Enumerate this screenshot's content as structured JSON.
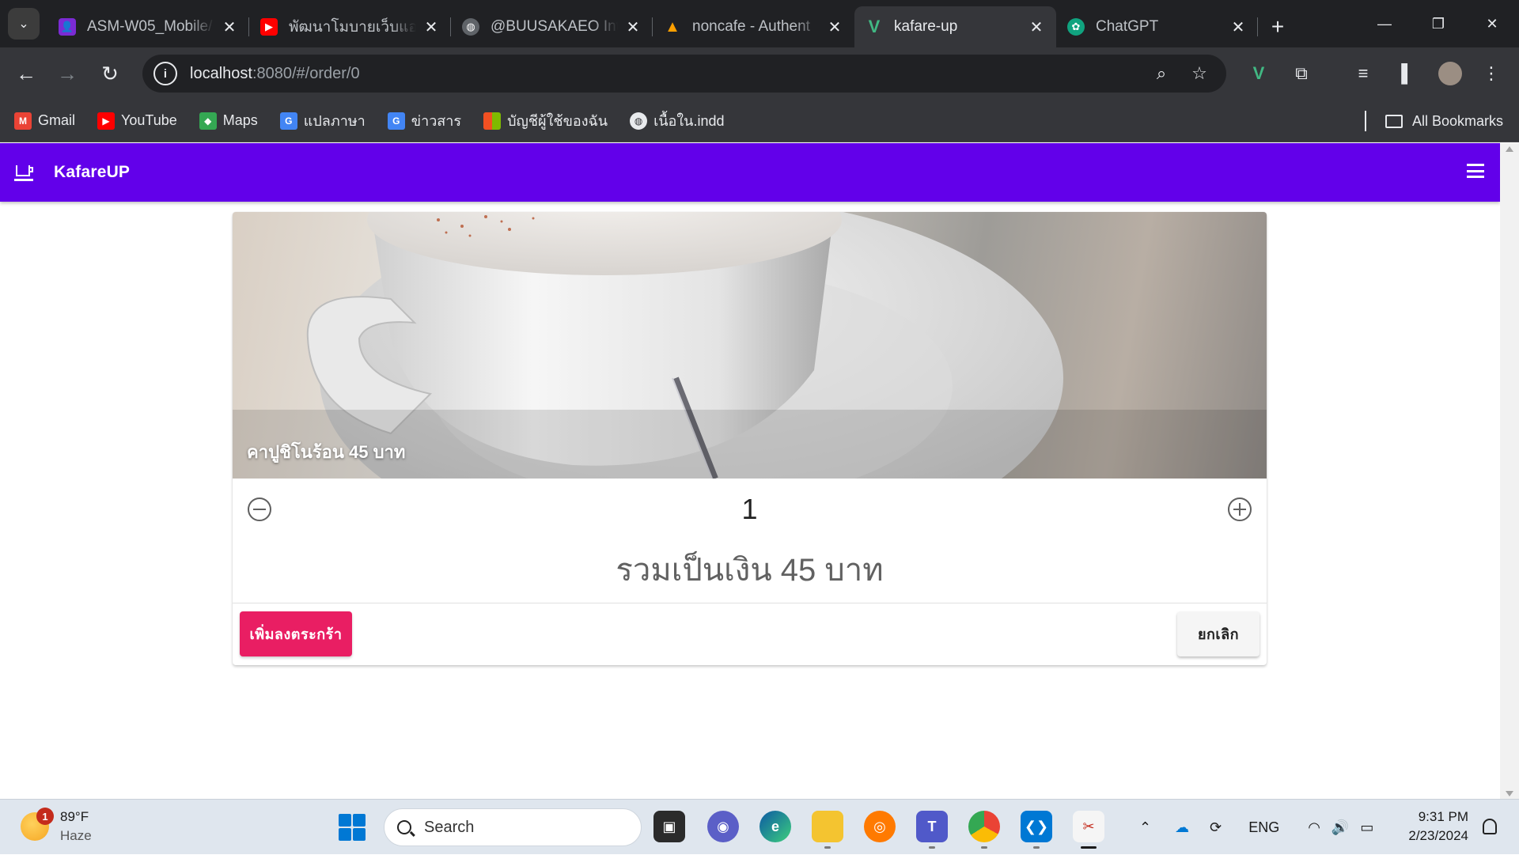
{
  "browser": {
    "tabs": [
      {
        "title": "ASM-W05_Mobile/",
        "icon": "person-icon",
        "color": "#7b2bd4",
        "active": false
      },
      {
        "title": "พัฒนาโมบายเว็บแอปแ",
        "icon": "youtube-icon",
        "color": "#ff0000",
        "active": false
      },
      {
        "title": "@BUUSAKAEO Inte",
        "icon": "globe-icon",
        "color": "#5f6368",
        "active": false
      },
      {
        "title": "noncafe - Authent",
        "icon": "firebase-icon",
        "color": "#ffa000",
        "active": false
      },
      {
        "title": "kafare-up",
        "icon": "vue-icon",
        "color": "#41b883",
        "active": true
      },
      {
        "title": "ChatGPT",
        "icon": "chatgpt-icon",
        "color": "#10a37f",
        "active": false
      }
    ],
    "url_host": "localhost",
    "url_rest": ":8080/#/order/0",
    "bookmarks": [
      {
        "label": "Gmail",
        "icon": "gmail-icon",
        "color": "#ea4335"
      },
      {
        "label": "YouTube",
        "icon": "youtube-icon",
        "color": "#ff0000"
      },
      {
        "label": "Maps",
        "icon": "maps-icon",
        "color": "#34a853"
      },
      {
        "label": "แปลภาษา",
        "icon": "translate-icon",
        "color": "#4285f4"
      },
      {
        "label": "ข่าวสาร",
        "icon": "news-icon",
        "color": "#4285f4"
      },
      {
        "label": "บัญชีผู้ใช้ของฉัน",
        "icon": "microsoft-icon",
        "color": "#f25022"
      },
      {
        "label": "เนื้อใน.indd",
        "icon": "globe-icon",
        "color": "#5f6368"
      }
    ],
    "all_bookmarks": "All Bookmarks"
  },
  "app": {
    "title": "KafareUP",
    "accent": "#6200ea",
    "product": {
      "caption": "คาปูชิโนร้อน 45 บาท",
      "quantity": "1",
      "total": "รวมเป็นเงิน 45 บาท"
    },
    "actions": {
      "add_to_cart": "เพิ่มลงตระกร้า",
      "cancel": "ยกเลิก"
    },
    "add_color": "#e91e63"
  },
  "taskbar": {
    "weather_temp": "89°F",
    "weather_desc": "Haze",
    "weather_badge": "1",
    "search_label": "Search",
    "lang": "ENG",
    "time": "9:31 PM",
    "date": "2/23/2024"
  }
}
